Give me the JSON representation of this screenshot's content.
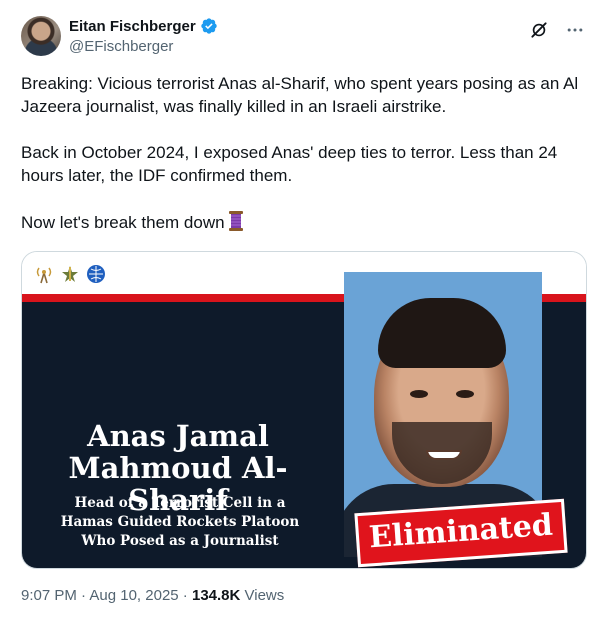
{
  "author": {
    "display_name": "Eitan Fischberger",
    "handle": "@EFischberger",
    "verified_icon": "verified-badge-icon",
    "verified_color": "#1d9bf0"
  },
  "tweet": {
    "paragraph_1": "Breaking: Vicious terrorist Anas al-Sharif, who spent years posing as an Al Jazeera journalist, was finally killed in an Israeli airstrike.",
    "paragraph_2": "Back in October 2024, I exposed Anas' deep ties to terror. Less than 24 hours later, the IDF confirmed them.",
    "paragraph_3": "Now let's break them down",
    "paragraph_3_emoji": "thread-spool-icon"
  },
  "media": {
    "headline_line_1": "Anas Jamal",
    "headline_line_2": "Mahmoud Al-Sharif",
    "subhead_line_1": "Head of a Terrorist Cell in a",
    "subhead_line_2": "Hamas Guided Rockets Platoon",
    "subhead_line_3": "Who Posed as a Journalist",
    "stamp": "Eliminated",
    "logos": [
      "radio-icon",
      "idf-emblem-icon",
      "globe-icon"
    ],
    "colors": {
      "stripe": "#d8141c",
      "dark_bg": "#0e1a2a",
      "stamp": "#e0141c"
    }
  },
  "meta": {
    "time": "9:07 PM",
    "separator_1": " · ",
    "date": "Aug 10, 2025",
    "separator_2": " · ",
    "views_count": "134.8K",
    "views_label": " Views"
  },
  "actions": {
    "grok_icon": "grok-icon",
    "more_icon": "more-options-icon"
  }
}
